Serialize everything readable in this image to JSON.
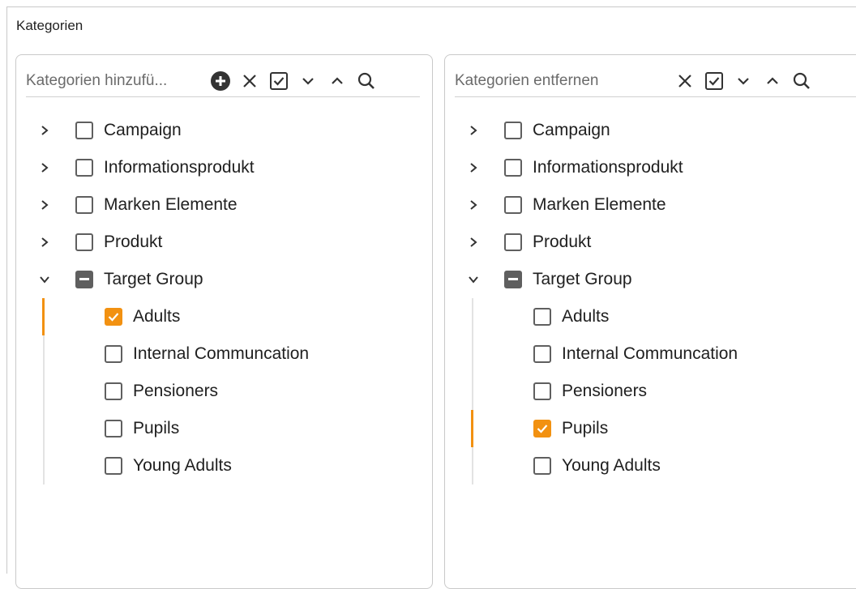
{
  "section_title": "Kategorien",
  "colors": {
    "accent": "#f29111",
    "indeterminate": "#5f5f5f",
    "border": "#c9c9c9"
  },
  "left_panel": {
    "search_placeholder": "Kategorien hinzufü...",
    "toolbar_icons": [
      "add-circle-icon",
      "close-icon",
      "check-all-icon",
      "expand-icon",
      "collapse-icon",
      "search-icon"
    ],
    "tree": [
      {
        "label": "Campaign",
        "state": "unchecked",
        "expanded": false
      },
      {
        "label": "Informationsprodukt",
        "state": "unchecked",
        "expanded": false
      },
      {
        "label": "Marken Elemente",
        "state": "unchecked",
        "expanded": false
      },
      {
        "label": "Produkt",
        "state": "unchecked",
        "expanded": false
      },
      {
        "label": "Target Group",
        "state": "indeterminate",
        "expanded": true,
        "children": [
          {
            "label": "Adults",
            "state": "checked"
          },
          {
            "label": "Internal Communcation",
            "state": "unchecked"
          },
          {
            "label": "Pensioners",
            "state": "unchecked"
          },
          {
            "label": "Pupils",
            "state": "unchecked"
          },
          {
            "label": "Young Adults",
            "state": "unchecked"
          }
        ]
      }
    ]
  },
  "right_panel": {
    "search_placeholder": "Kategorien entfernen",
    "toolbar_icons": [
      "close-icon",
      "check-all-icon",
      "expand-icon",
      "collapse-icon",
      "search-icon"
    ],
    "tree": [
      {
        "label": "Campaign",
        "state": "unchecked",
        "expanded": false
      },
      {
        "label": "Informationsprodukt",
        "state": "unchecked",
        "expanded": false
      },
      {
        "label": "Marken Elemente",
        "state": "unchecked",
        "expanded": false
      },
      {
        "label": "Produkt",
        "state": "unchecked",
        "expanded": false
      },
      {
        "label": "Target Group",
        "state": "indeterminate",
        "expanded": true,
        "children": [
          {
            "label": "Adults",
            "state": "unchecked"
          },
          {
            "label": "Internal Communcation",
            "state": "unchecked"
          },
          {
            "label": "Pensioners",
            "state": "unchecked"
          },
          {
            "label": "Pupils",
            "state": "checked"
          },
          {
            "label": "Young Adults",
            "state": "unchecked"
          }
        ]
      }
    ]
  }
}
